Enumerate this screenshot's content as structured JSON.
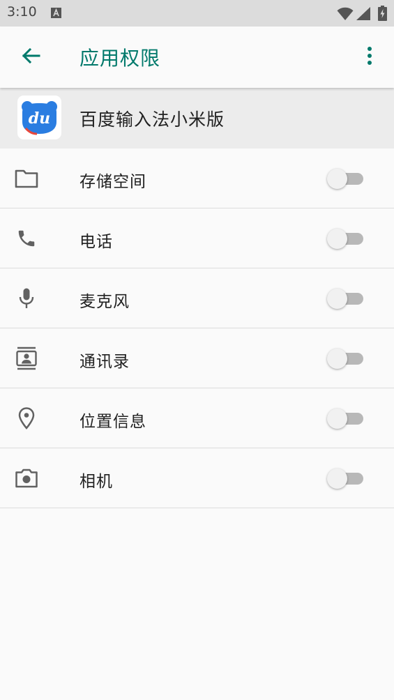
{
  "status_bar": {
    "time": "3:10",
    "notification_icon": "a-letter-icon",
    "icons": [
      "wifi-icon",
      "signal-icon",
      "battery-charging-icon"
    ]
  },
  "toolbar": {
    "back_icon": "arrow-back-icon",
    "title": "应用权限",
    "more_icon": "more-vert-icon"
  },
  "app": {
    "icon": "baidu-input-du-icon",
    "icon_text": "du",
    "name": "百度输入法小米版"
  },
  "permissions": [
    {
      "icon": "folder-icon",
      "label": "存储空间",
      "enabled": false
    },
    {
      "icon": "phone-icon",
      "label": "电话",
      "enabled": false
    },
    {
      "icon": "microphone-icon",
      "label": "麦克风",
      "enabled": false
    },
    {
      "icon": "contacts-icon",
      "label": "通讯录",
      "enabled": false
    },
    {
      "icon": "location-pin-icon",
      "label": "位置信息",
      "enabled": false
    },
    {
      "icon": "camera-icon",
      "label": "相机",
      "enabled": false
    }
  ],
  "colors": {
    "accent": "#00796b",
    "switch_track_off": "#b8b8b8",
    "switch_thumb_off": "#f1f1f1",
    "app_icon_blue": "#2a7de1"
  }
}
